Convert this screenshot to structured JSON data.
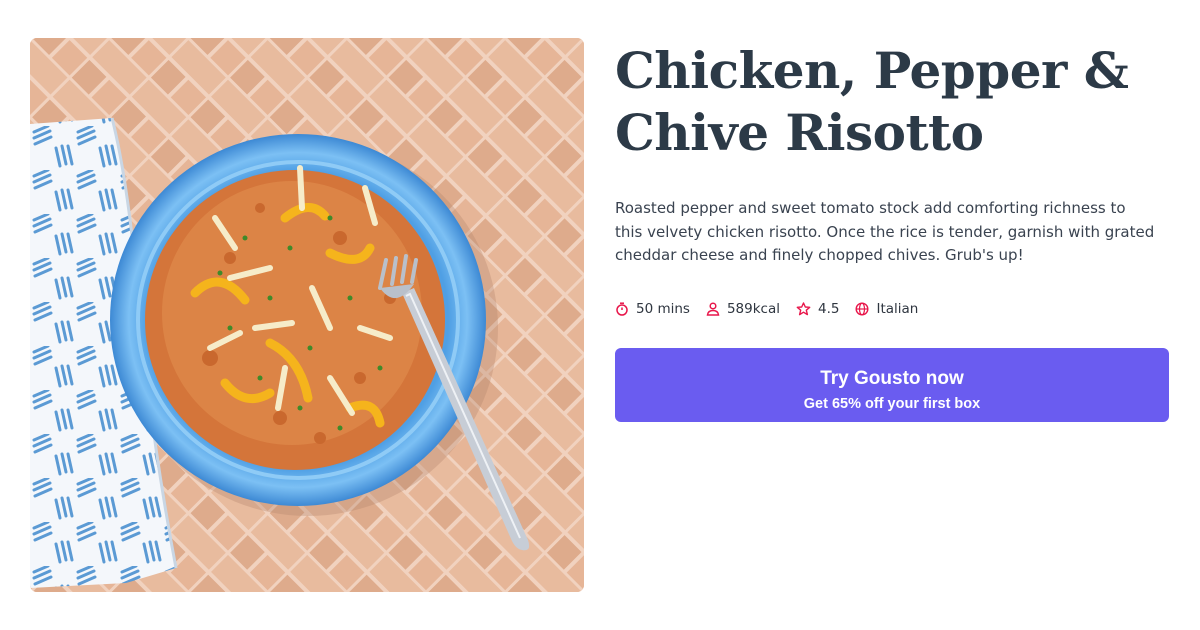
{
  "recipe": {
    "title_line1": "Chicken, Pepper &",
    "title_line2": "Chive Risotto",
    "description": "Roasted pepper and sweet tomato stock add comforting richness to this velvety chicken risotto. Once the rice is tender, garnish with grated cheddar cheese and finely chopped chives. Grub's up!",
    "image_alt": "Chicken, Pepper & Chive Risotto"
  },
  "meta": {
    "time": "50 mins",
    "calories": "589kcal",
    "rating": "4.5",
    "cuisine": "Italian",
    "icon_color": "#e8174b",
    "icons": [
      "stopwatch-icon",
      "person-icon",
      "star-icon",
      "globe-icon"
    ]
  },
  "cta": {
    "title": "Try Gousto now",
    "subtitle": "Get 65% off your first box",
    "color": "#6a5cf0"
  }
}
